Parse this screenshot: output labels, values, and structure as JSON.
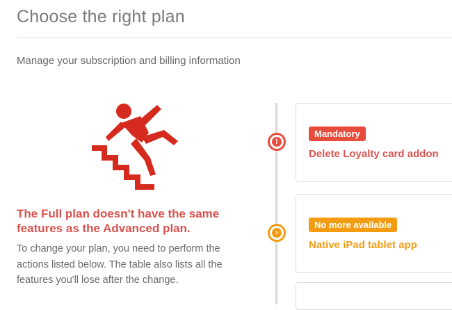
{
  "header": {
    "title": "Choose the right plan",
    "subtitle": "Manage your subscription and billing information"
  },
  "warning": {
    "icon": "falling-down-stairs-icon",
    "heading": "The Full plan doesn't have the same features as the Advanced plan.",
    "body": "To change your plan, you need to perform the actions listed below. The table also lists all the features you'll lose after the change."
  },
  "actions": [
    {
      "badge": "Mandatory",
      "title": "Delete Loyalty card addon",
      "marker_icon": "exclamation-icon",
      "color": "#e74c3c"
    },
    {
      "badge": "No more available",
      "title": "Native iPad tablet app",
      "marker_icon": "chevron-right-icon",
      "color": "#f39c12"
    }
  ],
  "colors": {
    "danger": "#d9534f",
    "warning": "#f39c12",
    "text": "#666666"
  }
}
